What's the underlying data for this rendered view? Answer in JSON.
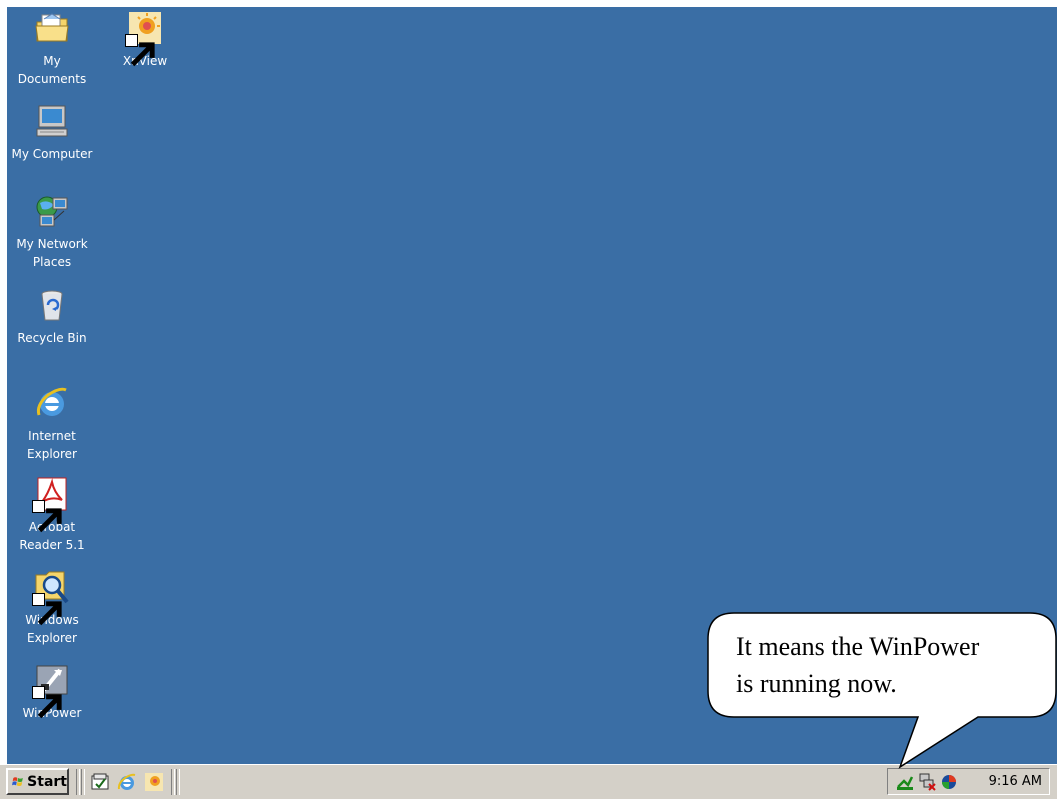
{
  "desktop": {
    "background_color": "#3a6ea5",
    "icons": [
      {
        "label": "My\nDocuments",
        "icon": "my-documents-icon"
      },
      {
        "label": "XnView",
        "icon": "xnview-icon",
        "shortcut": true
      },
      {
        "label": "My Computer",
        "icon": "my-computer-icon"
      },
      {
        "label": "My Network\nPlaces",
        "icon": "network-places-icon"
      },
      {
        "label": "Recycle Bin",
        "icon": "recycle-bin-icon"
      },
      {
        "label": "Internet\nExplorer",
        "icon": "internet-explorer-icon"
      },
      {
        "label": "Acrobat\nReader 5.1",
        "icon": "acrobat-reader-icon",
        "shortcut": true
      },
      {
        "label": "Windows\nExplorer",
        "icon": "windows-explorer-icon",
        "shortcut": true
      },
      {
        "label": "WinPower",
        "icon": "winpower-icon",
        "shortcut": true
      }
    ]
  },
  "taskbar": {
    "start_label": "Start",
    "quick_launch": [
      "show-desktop-icon",
      "internet-explorer-icon",
      "xnview-icon"
    ],
    "tray_icons": [
      "winpower-tray-icon",
      "network-disconnected-icon",
      "app-tray-icon"
    ],
    "clock": "9:16 AM"
  },
  "callout": {
    "text": "It means the WinPower\nis running now."
  }
}
